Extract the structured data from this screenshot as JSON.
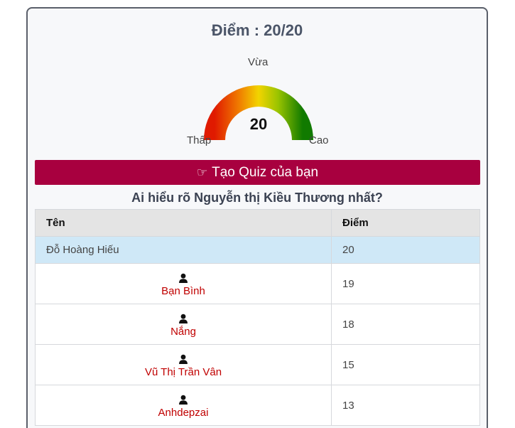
{
  "score": {
    "title": "Điểm : 20/20",
    "value": "20",
    "level_fraction": 1.0
  },
  "gauge": {
    "low_label": "Thấp",
    "mid_label": "Vừa",
    "high_label": "Cao"
  },
  "quiz_button": {
    "icon": "hand-pointing-icon",
    "label": "Tạo Quiz của bạn"
  },
  "leaderboard": {
    "title": "Ai hiểu rõ Nguyễn thị Kiều Thương nhất?",
    "columns": [
      "Tên",
      "Điểm"
    ],
    "top_row": {
      "name": "Đỗ Hoàng Hiếu",
      "score": "20"
    },
    "rows": [
      {
        "name": "Bạn Bình",
        "score": "19"
      },
      {
        "name": "Nắng",
        "score": "18"
      },
      {
        "name": "Vũ Thị Trần Vân",
        "score": "15"
      },
      {
        "name": "Anhdepzai",
        "score": "13"
      }
    ]
  },
  "colors": {
    "button_bg": "#a8003f",
    "name_link": "#c00000",
    "highlight_row": "#cfe8f7"
  }
}
